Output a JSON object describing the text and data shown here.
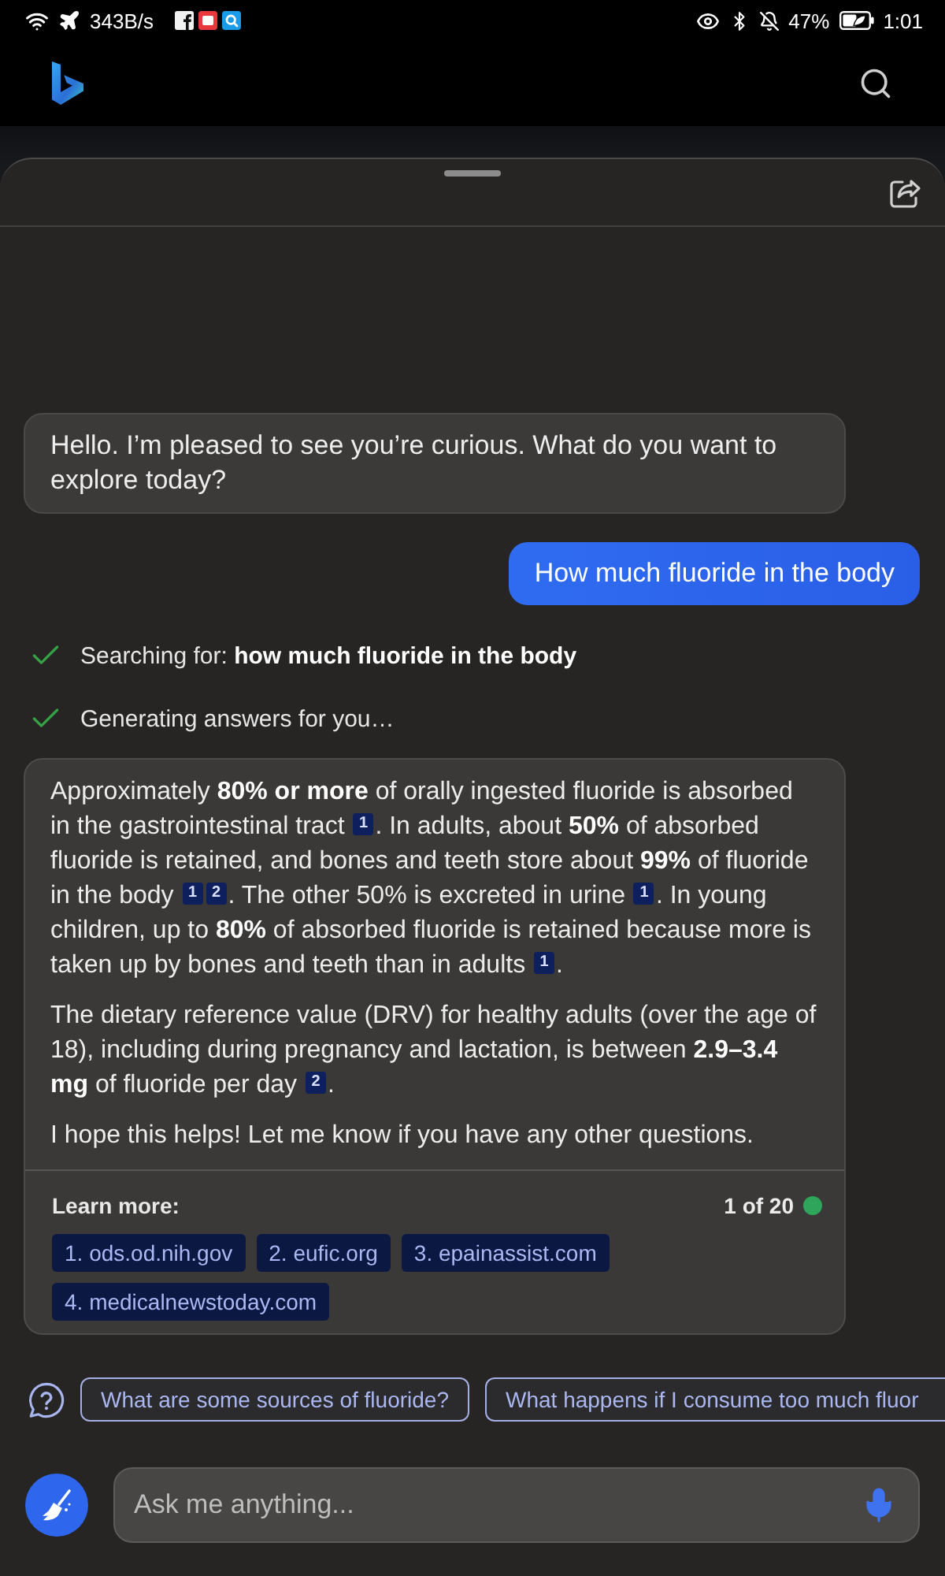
{
  "status_bar": {
    "speed": "343B/s",
    "battery": "47%",
    "time": "1:01"
  },
  "messages": [
    {
      "kind": "bot",
      "text": "Hello. I’m pleased to see you’re curious. What do you want to explore today?"
    },
    {
      "kind": "user",
      "text": "How much fluoride in the body"
    },
    {
      "kind": "progress",
      "done": true,
      "text": "Searching for: **how much fluoride in the body**"
    },
    {
      "kind": "progress",
      "done": true,
      "text": "Generating answers for you…"
    },
    {
      "kind": "answer",
      "paragraphs": [
        [
          {
            "kind": "text",
            "text": "Approximately **80% or more** of orally ingested fluoride is absorbed in the gastrointestinal tract "
          },
          {
            "kind": "cite",
            "text": "1"
          },
          {
            "kind": "text",
            "text": ". In adults, about **50%** of absorbed fluoride is retained, and bones and teeth store about **99%** of fluoride in the body "
          },
          {
            "kind": "cite",
            "text": "1"
          },
          {
            "kind": "cite",
            "text": "2"
          },
          {
            "kind": "text",
            "text": ". The other 50% is excreted in urine "
          },
          {
            "kind": "cite",
            "text": "1"
          },
          {
            "kind": "text",
            "text": ". In young children, up to **80%** of absorbed fluoride is retained because more is taken up by bones and teeth than in adults "
          },
          {
            "kind": "cite",
            "text": "1"
          },
          {
            "kind": "text",
            "text": "."
          }
        ],
        [
          {
            "kind": "text",
            "text": "The dietary reference value (DRV) for healthy adults (over the age of 18), including during pregnancy and lactation, is between **2.9–3.4 mg** of fluoride per day "
          },
          {
            "kind": "cite",
            "text": "2"
          },
          {
            "kind": "text",
            "text": "."
          }
        ],
        [
          {
            "kind": "text",
            "text": "I hope this helps! Let me know if you have any other questions."
          }
        ]
      ],
      "learn_more": {
        "label": "Learn more:",
        "count": "1 of 20",
        "sources": [
          "1. ods.od.nih.gov",
          "2. eufic.org",
          "3. epainassist.com",
          "4. medicalnewstoday.com"
        ]
      }
    }
  ],
  "suggestions": [
    "What are some sources of fluoride?",
    "What happens if I consume too much fluor"
  ],
  "input": {
    "placeholder": "Ask me anything..."
  }
}
